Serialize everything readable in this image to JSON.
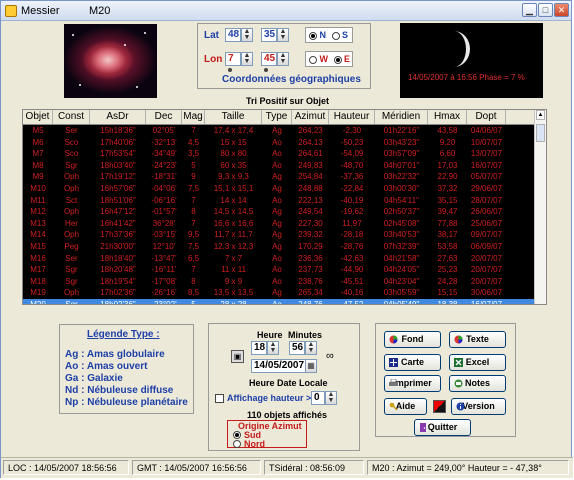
{
  "window": {
    "app_title": "Messier",
    "object_title": "M20"
  },
  "coords": {
    "lat_label": "Lat",
    "lat_deg": "48",
    "lat_min": "35",
    "lon_label": "Lon",
    "lon_deg": "7",
    "lon_min": "45",
    "north": "N",
    "south": "S",
    "west": "W",
    "east": "E",
    "title": "Coordonnées géographiques"
  },
  "moon": {
    "text": "14/05/2007 à 16:56 Phase = 7 %"
  },
  "table": {
    "caption": "Tri Positif sur Objet",
    "headers": [
      "Objet",
      "Const",
      "AsDr",
      "Dec",
      "Mag",
      "Taille",
      "Type",
      "Azimut",
      "Hauteur",
      "Méridien",
      "Hmax",
      "Dopt"
    ],
    "rows": [
      [
        "M5",
        "Ser",
        "15h18'36\"",
        "02°05'",
        "7",
        "17,4 x 17,4",
        "Ag",
        "264,23",
        "-2,30",
        "01h22'16\"",
        "43,58",
        "04/06/07"
      ],
      [
        "M6",
        "Sco",
        "17h40'06\"",
        "-32°13'",
        "4,5",
        "15 x 15",
        "Ao",
        "264,13",
        "-50,23",
        "03h43'23\"",
        "9,20",
        "10/07/07"
      ],
      [
        "M7",
        "Sco",
        "17h53'54\"",
        "-34°49'",
        "3,5",
        "80 x 80",
        "Ao",
        "264,61",
        "-54,09",
        "03h57'09\"",
        "6,60",
        "13/07/07"
      ],
      [
        "M8",
        "Sgr",
        "18h03'40\"",
        "-24°23'",
        "5",
        "60 x 35",
        "Ao",
        "249,83",
        "-48,70",
        "04h07'01\"",
        "17,03",
        "16/07/07"
      ],
      [
        "M9",
        "Oph",
        "17h19'12\"",
        "-18°31'",
        "9",
        "9,3 x 9,3",
        "Ag",
        "254,84",
        "-37,36",
        "03h22'32\"",
        "22,90",
        "05/07/07"
      ],
      [
        "M10",
        "Oph",
        "16h57'06\"",
        "-04°06'",
        "7,5",
        "15,1 x 15,1",
        "Ag",
        "248,88",
        "-22,84",
        "03h00'30\"",
        "37,32",
        "29/06/07"
      ],
      [
        "M11",
        "Sct",
        "18h51'06\"",
        "-06°16'",
        "7",
        "14 x 14",
        "Ao",
        "222,13",
        "-40,19",
        "04h54'11\"",
        "35,15",
        "28/07/07"
      ],
      [
        "M12",
        "Oph",
        "16h47'12\"",
        "-01°57'",
        "8",
        "14,5 x 14,5",
        "Ag",
        "249,54",
        "-19,62",
        "02h50'37\"",
        "39,47",
        "26/06/07"
      ],
      [
        "M13",
        "Her",
        "16h41'42\"",
        "36°28'",
        "7",
        "16,6 x 16,6",
        "Ag",
        "227,30",
        "11,97",
        "02h45'08\"",
        "77,88",
        "25/06/07"
      ],
      [
        "M14",
        "Oph",
        "17h37'36\"",
        "-03°15'",
        "9,5",
        "11,7 x 11,7",
        "Ag",
        "239,32",
        "-28,18",
        "03h40'53\"",
        "38,17",
        "09/07/07"
      ],
      [
        "M15",
        "Peg",
        "21h30'00\"",
        "12°10'",
        "7,5",
        "12,3 x 12,3",
        "Ag",
        "170,29",
        "-28,76",
        "07h32'39\"",
        "53,58",
        "06/09/07"
      ],
      [
        "M16",
        "Ser",
        "18h18'40\"",
        "-13°47'",
        "6,5",
        "7 x 7",
        "Ao",
        "236,36",
        "-42,63",
        "04h21'58\"",
        "27,63",
        "20/07/07"
      ],
      [
        "M17",
        "Sgr",
        "18h20'48\"",
        "-16°11'",
        "7",
        "11 x 11",
        "Ao",
        "237,73",
        "-44,90",
        "04h24'05\"",
        "25,23",
        "20/07/07"
      ],
      [
        "M18",
        "Sgr",
        "18h19'54\"",
        "-17°08'",
        "8",
        "9 x 9",
        "Ao",
        "238,76",
        "-45,51",
        "04h23'04\"",
        "24,28",
        "20/07/07"
      ],
      [
        "M19",
        "Oph",
        "17h02'36\"",
        "-26°16'",
        "8,5",
        "13,5 x 13,5",
        "Ag",
        "265,34",
        "-40,16",
        "03h05'59\"",
        "15,15",
        "30/06/07"
      ],
      [
        "M20",
        "Sgr",
        "18h02'36\"",
        "-23°02'",
        "5",
        "28 x 28",
        "Ao",
        "248,76",
        "-47,52",
        "04h05'49\"",
        "18,38",
        "16/07/07"
      ]
    ],
    "selected_index": 15
  },
  "legend": {
    "title": "Légende Type :",
    "items": [
      "Ag : Amas globulaire",
      "Ao : Amas ouvert",
      "Ga : Galaxie",
      "Nd : Nébuleuse diffuse",
      "Np : Nébuleuse planétaire"
    ]
  },
  "time": {
    "heure_label": "Heure",
    "minutes_label": "Minutes",
    "hour": "18",
    "minute": "56",
    "date": "14/05/2007",
    "section_label": "Heure Date Locale",
    "affichage_label": "Affichage hauteur >",
    "affichage_value": "0",
    "count_text": "110 objets affichés",
    "origin_title": "Origine Azimut",
    "sud": "Sud",
    "nord": "Nord"
  },
  "buttons": {
    "fond": "Fond",
    "texte": "Texte",
    "carte": "Carte",
    "excel": "Excel",
    "imprimer": "Imprimer",
    "notes": "Notes",
    "aide": "Aide",
    "version": "Version",
    "quitter": "Quitter"
  },
  "status": {
    "loc": "LOC : 14/05/2007 18:56:56",
    "gmt": "GMT : 14/05/2007 16:56:56",
    "tsid": "TSidéral : 08:56:09",
    "azimut": "M20 : Azimut = 249,00°  Hauteur = - 47,38°"
  }
}
